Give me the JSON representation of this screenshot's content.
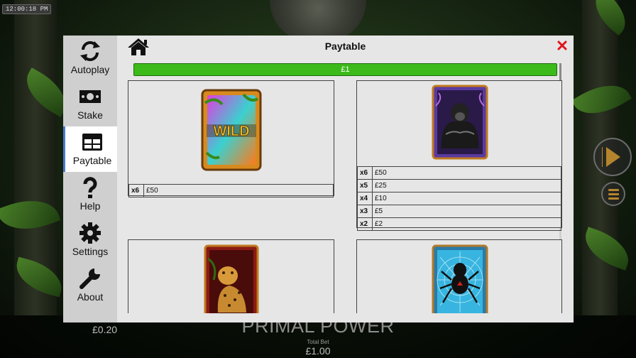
{
  "status": {
    "clock": "12:00:18 PM"
  },
  "game": {
    "title": "PRIMAL POWER",
    "bet_left": "£0.20",
    "total_bet_label": "Total Bet",
    "total_bet_value": "£1.00"
  },
  "modal": {
    "title": "Paytable",
    "stake_label": "£1",
    "sidebar": [
      {
        "label": "Autoplay",
        "icon": "refresh-icon"
      },
      {
        "label": "Stake",
        "icon": "banknote-icon"
      },
      {
        "label": "Paytable",
        "icon": "table-icon",
        "active": true
      },
      {
        "label": "Help",
        "icon": "question-icon"
      },
      {
        "label": "Settings",
        "icon": "gear-icon"
      },
      {
        "label": "About",
        "icon": "wrench-icon"
      }
    ],
    "symbols": [
      {
        "name": "wild",
        "symbol_text": "WILD",
        "pays": [
          {
            "mult": "x6",
            "value": "£50"
          }
        ]
      },
      {
        "name": "gorilla",
        "pays": [
          {
            "mult": "x6",
            "value": "£50"
          },
          {
            "mult": "x5",
            "value": "£25"
          },
          {
            "mult": "x4",
            "value": "£10"
          },
          {
            "mult": "x3",
            "value": "£5"
          },
          {
            "mult": "x2",
            "value": "£2"
          }
        ]
      },
      {
        "name": "leopard",
        "pays": []
      },
      {
        "name": "spider",
        "pays": []
      }
    ]
  },
  "colors": {
    "accent": "#3bba1a",
    "close": "#e0141a",
    "active_nav": "#4a7bd0",
    "spin": "#b5852e"
  }
}
